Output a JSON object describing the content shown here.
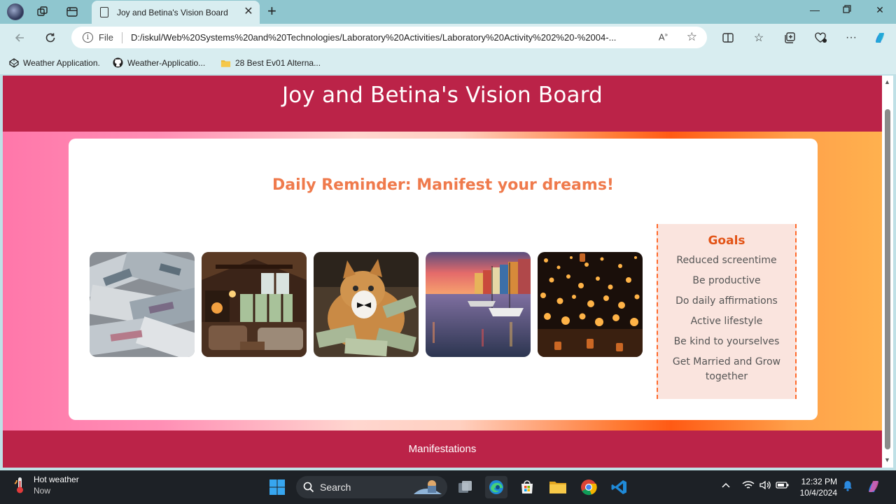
{
  "browser": {
    "tab_title": "Joy and Betina's Vision Board",
    "address": {
      "scheme": "File",
      "url": "D:/iskul/Web%20Systems%20and%20Technologies/Laboratory%20Activities/Laboratory%20Activity%202%20-%2004-..."
    },
    "bookmarks": [
      {
        "label": "Weather Application.",
        "icon": "codepen-icon"
      },
      {
        "label": "Weather-Applicatio...",
        "icon": "github-icon"
      },
      {
        "label": "28 Best Ev01 Alterna...",
        "icon": "folder-icon"
      }
    ]
  },
  "page": {
    "header_title": "Joy and Betina's Vision Board",
    "reminder": "Daily Reminder: Manifest your dreams!",
    "images": [
      {
        "name": "money-pile"
      },
      {
        "name": "cozy-living-room"
      },
      {
        "name": "cat-with-money"
      },
      {
        "name": "harbor-city"
      },
      {
        "name": "sky-lanterns"
      }
    ],
    "goals": {
      "title": "Goals",
      "items": [
        "Reduced screentime",
        "Be productive",
        "Do daily affirmations",
        "Active lifestyle",
        "Be kind to yourselves",
        "Get Married and Grow together"
      ]
    },
    "footer": "Manifestations",
    "colors": {
      "header_bg": "#bb2348",
      "reminder": "#ef7a4c",
      "goals_title": "#e25316",
      "goals_bg": "#fae4de",
      "goals_border": "#ff6a2c"
    }
  },
  "taskbar": {
    "weather_title": "Hot weather",
    "weather_sub": "Now",
    "search_label": "Search",
    "time": "12:32 PM",
    "date": "10/4/2024"
  }
}
